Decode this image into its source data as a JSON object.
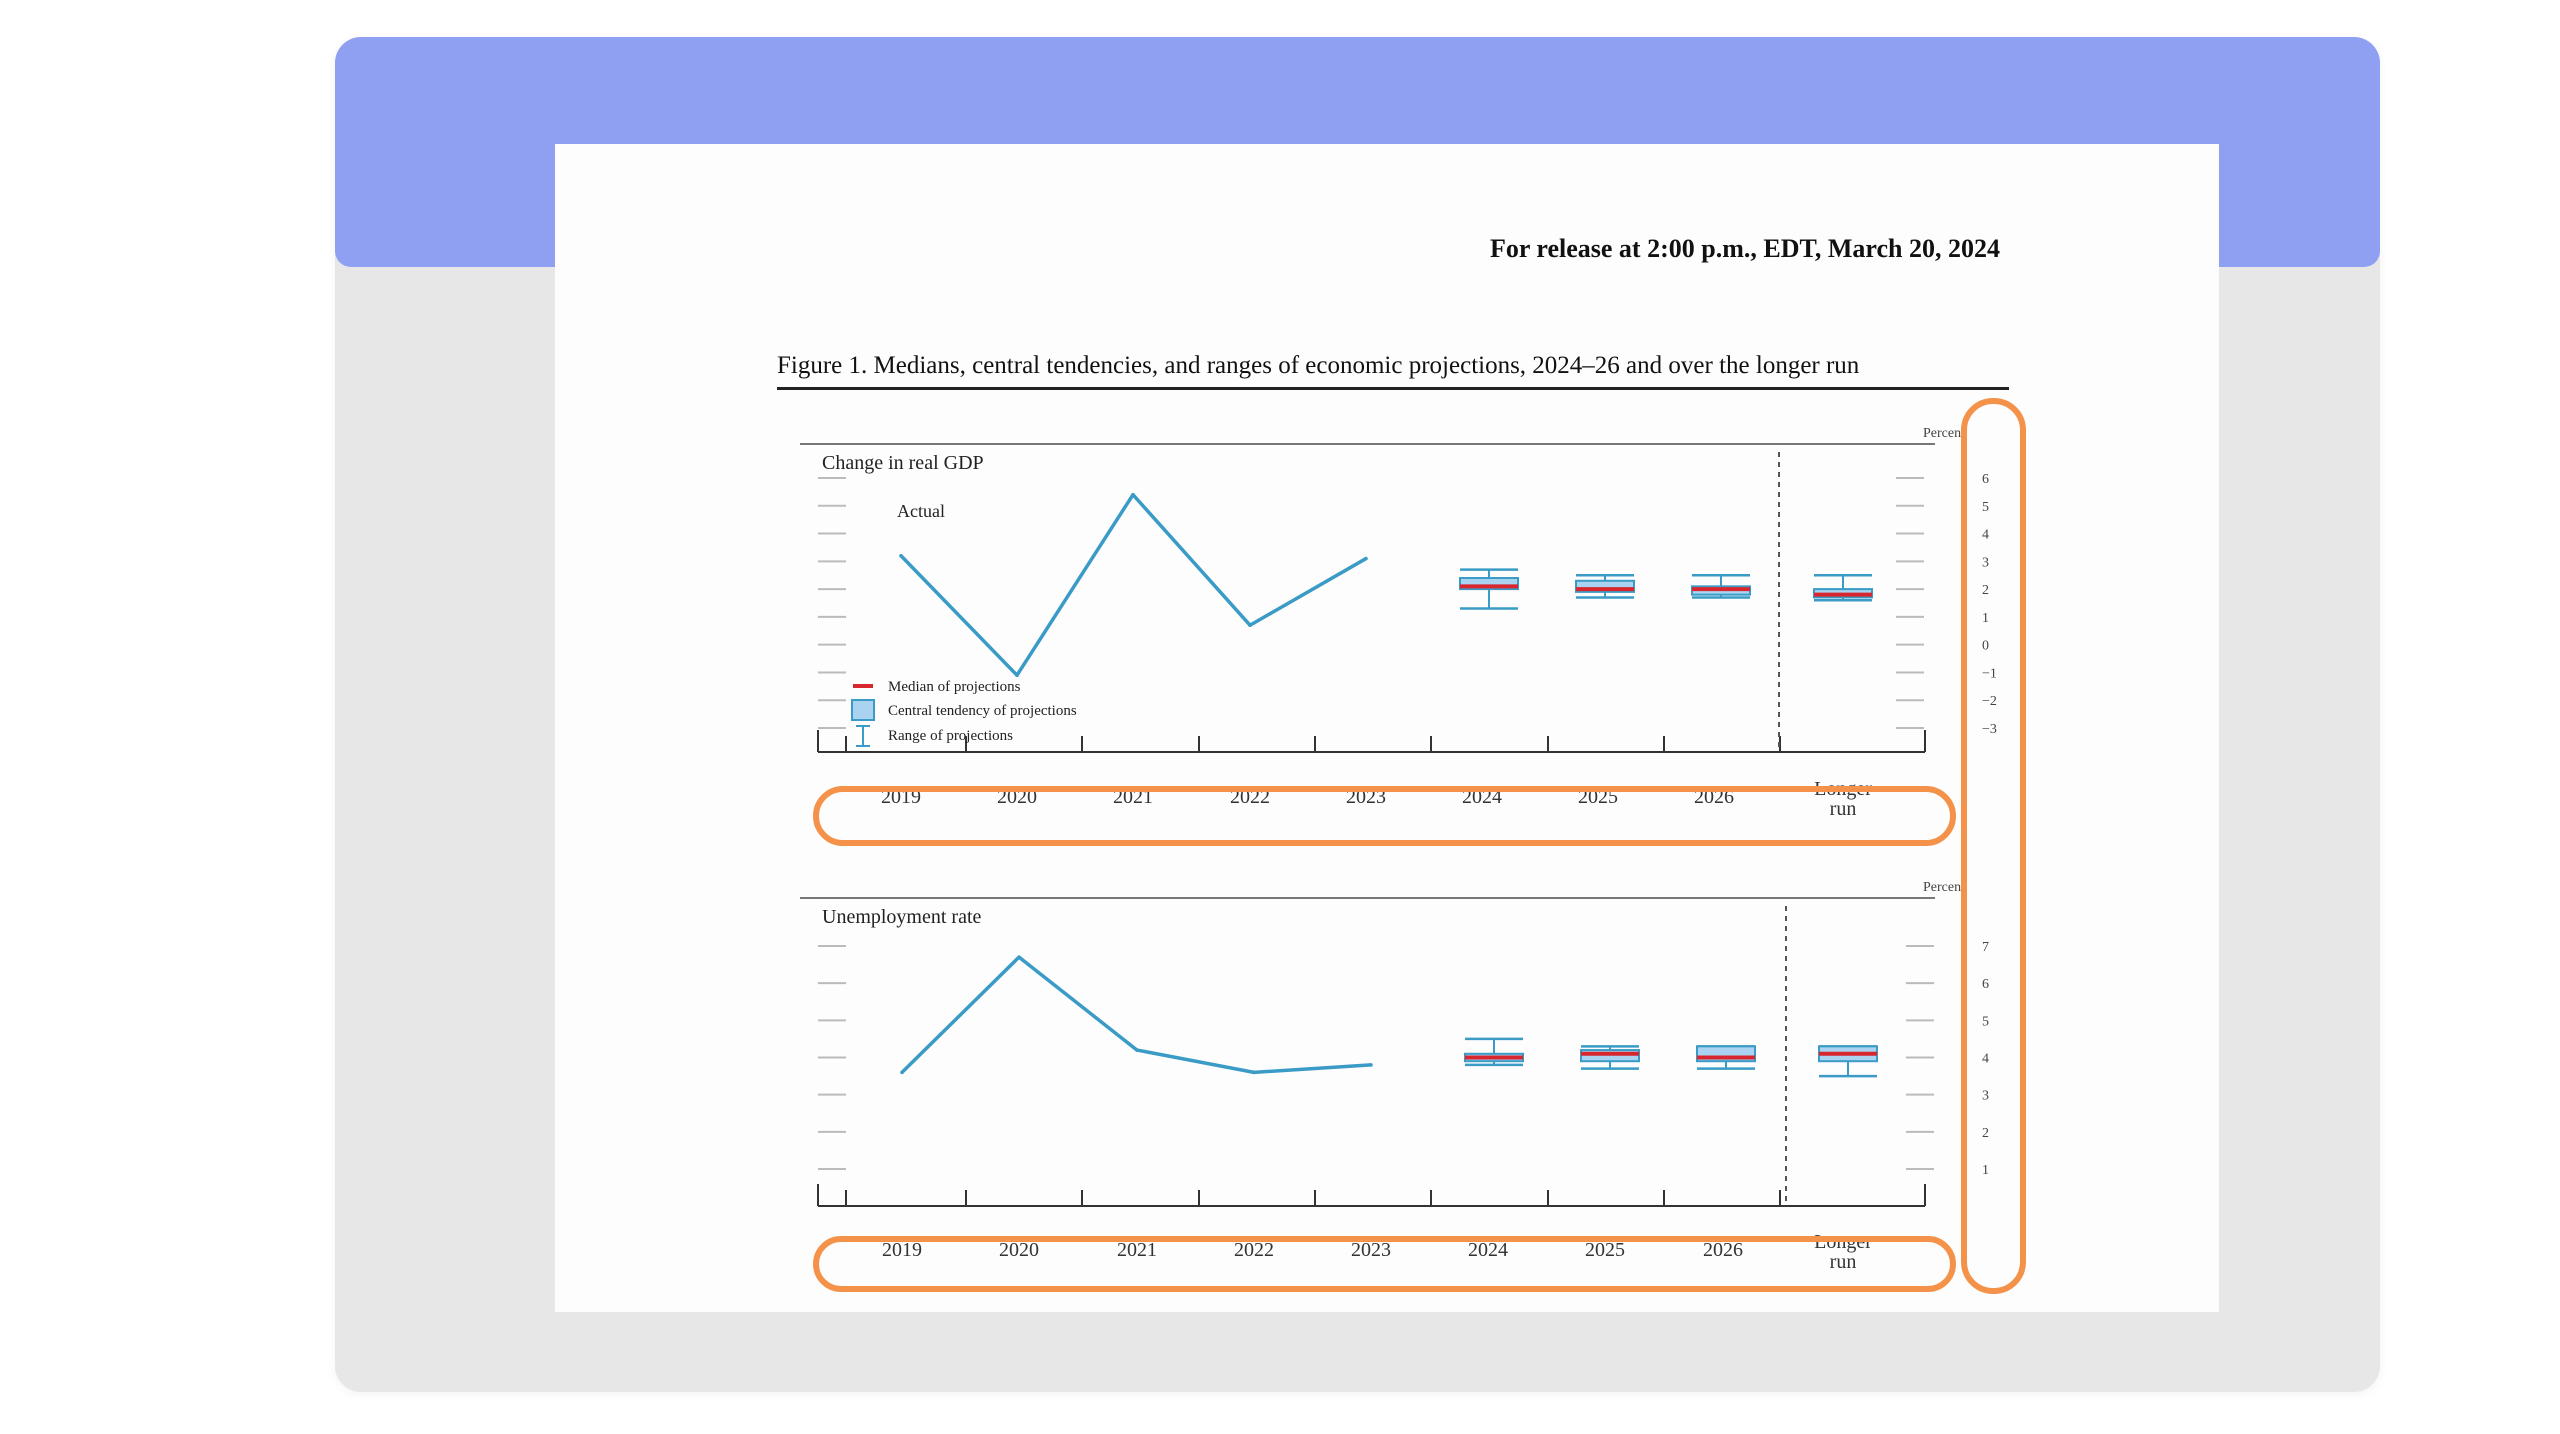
{
  "document": {
    "release": "For release at 2:00 p.m., EDT, March 20, 2024",
    "figure_caption": "Figure 1. Medians, central tendencies, and ranges of economic projections, 2024–26 and over the longer run"
  },
  "colors": {
    "card": "#e7e7e7",
    "header_band": "#8fa0f2",
    "line": "#3a9bc6",
    "box_fill": "#a9d3f0",
    "median": "#d8262e",
    "highlight": "#f4924a"
  },
  "legend": {
    "median": "Median of projections",
    "central": "Central tendency of projections",
    "range": "Range of projections"
  },
  "chart_data": [
    {
      "type": "line",
      "title": "Change in real GDP",
      "ylabel": "Percent",
      "annotation": "Actual",
      "ylim": [
        -3,
        6
      ],
      "yticks": [
        "6",
        "5",
        "4",
        "3",
        "2",
        "1",
        "0",
        "−1",
        "−2",
        "−3"
      ],
      "categories": [
        "2019",
        "2020",
        "2021",
        "2022",
        "2023",
        "2024",
        "2025",
        "2026",
        "Longer run"
      ],
      "actual": {
        "x": [
          "2019",
          "2020",
          "2021",
          "2022",
          "2023"
        ],
        "values": [
          3.2,
          -1.1,
          5.4,
          0.7,
          3.1
        ]
      },
      "projections": [
        {
          "x": "2024",
          "median": 2.1,
          "central": [
            2.0,
            2.4
          ],
          "range": [
            1.3,
            2.7
          ]
        },
        {
          "x": "2025",
          "median": 2.0,
          "central": [
            1.9,
            2.3
          ],
          "range": [
            1.7,
            2.5
          ]
        },
        {
          "x": "2026",
          "median": 2.0,
          "central": [
            1.8,
            2.1
          ],
          "range": [
            1.7,
            2.5
          ]
        },
        {
          "x": "Longer run",
          "median": 1.8,
          "central": [
            1.7,
            2.0
          ],
          "range": [
            1.6,
            2.5
          ]
        }
      ]
    },
    {
      "type": "line",
      "title": "Unemployment rate",
      "ylabel": "Percent",
      "ylim": [
        1,
        7
      ],
      "yticks": [
        "7",
        "6",
        "5",
        "4",
        "3",
        "2",
        "1"
      ],
      "categories": [
        "2019",
        "2020",
        "2021",
        "2022",
        "2023",
        "2024",
        "2025",
        "2026",
        "Longer run"
      ],
      "actual": {
        "x": [
          "2019",
          "2020",
          "2021",
          "2022",
          "2023"
        ],
        "values": [
          3.6,
          6.7,
          4.2,
          3.6,
          3.8
        ]
      },
      "projections": [
        {
          "x": "2024",
          "median": 4.0,
          "central": [
            3.9,
            4.1
          ],
          "range": [
            3.8,
            4.5
          ]
        },
        {
          "x": "2025",
          "median": 4.1,
          "central": [
            3.9,
            4.2
          ],
          "range": [
            3.7,
            4.3
          ]
        },
        {
          "x": "2026",
          "median": 4.0,
          "central": [
            3.9,
            4.3
          ],
          "range": [
            3.7,
            4.3
          ]
        },
        {
          "x": "Longer run",
          "median": 4.1,
          "central": [
            3.9,
            4.3
          ],
          "range": [
            3.5,
            4.3
          ]
        }
      ]
    }
  ]
}
